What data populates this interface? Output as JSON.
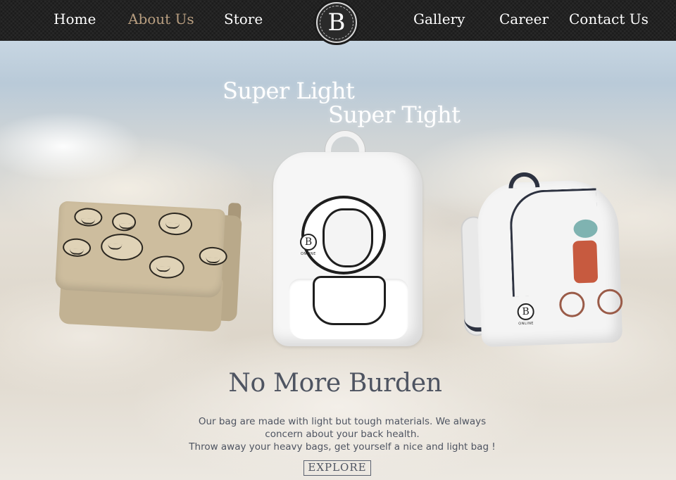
{
  "nav": {
    "left_items": [
      {
        "label": "Home"
      },
      {
        "label": "About Us"
      },
      {
        "label": "Store"
      }
    ],
    "logo_letter": "B",
    "right_items": [
      {
        "label": "Gallery"
      },
      {
        "label": "Career"
      },
      {
        "label": "Contact Us"
      }
    ],
    "active_item": "About Us"
  },
  "hero": {
    "tagline_line1": "Super Light",
    "tagline_line2": "Super Tight",
    "headline": "No More Burden",
    "description_line1": "Our bag are made with light but tough materials. We always",
    "description_line2": "concern about your back health.",
    "description_line3": "Throw away your heavy bags, get yourself a nice and light bag !",
    "cta_label": "EXPLORE",
    "brand_badge_letter": "B",
    "brand_badge_sub": "ONLINE"
  },
  "colors": {
    "nav_bg": "#1b1b1b",
    "nav_text": "#ffffff",
    "nav_active": "#b89e80",
    "headline": "#4e5461"
  }
}
